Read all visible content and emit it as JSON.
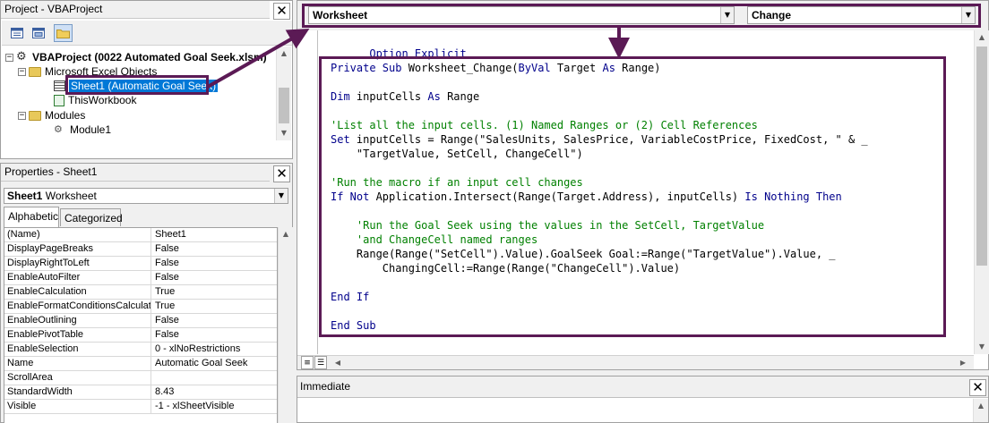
{
  "project": {
    "title": "Project - VBAProject",
    "project_name": "VBAProject (0022 Automated Goal Seek.xlsm)",
    "folder_objects": "Microsoft Excel Objects",
    "sheet1": "Sheet1 (Automatic Goal Seek)",
    "workbook": "ThisWorkbook",
    "folder_modules": "Modules",
    "module1": "Module1"
  },
  "properties": {
    "title": "Properties - Sheet1",
    "object_name": "Sheet1",
    "object_type": "Worksheet",
    "tabs": [
      "Alphabetic",
      "Categorized"
    ],
    "rows": [
      {
        "name": "(Name)",
        "value": "Sheet1"
      },
      {
        "name": "DisplayPageBreaks",
        "value": "False"
      },
      {
        "name": "DisplayRightToLeft",
        "value": "False"
      },
      {
        "name": "EnableAutoFilter",
        "value": "False"
      },
      {
        "name": "EnableCalculation",
        "value": "True"
      },
      {
        "name": "EnableFormatConditionsCalculation",
        "value": "True"
      },
      {
        "name": "EnableOutlining",
        "value": "False"
      },
      {
        "name": "EnablePivotTable",
        "value": "False"
      },
      {
        "name": "EnableSelection",
        "value": "0 - xlNoRestrictions"
      },
      {
        "name": "Name",
        "value": "Automatic Goal Seek"
      },
      {
        "name": "ScrollArea",
        "value": ""
      },
      {
        "name": "StandardWidth",
        "value": "8.43"
      },
      {
        "name": "Visible",
        "value": "-1 - xlSheetVisible"
      }
    ]
  },
  "code": {
    "object_combo": "Worksheet",
    "proc_combo": "Change",
    "lines": {
      "l0": "Option Explicit",
      "l1a": "Private Sub ",
      "l1b": "Worksheet_Change(",
      "l1c": "ByVal ",
      "l1d": "Target ",
      "l1e": "As ",
      "l1f": "Range)",
      "l2a": "Dim ",
      "l2b": "inputCells ",
      "l2c": "As ",
      "l2d": "Range",
      "l3": "'List all the input cells. (1) Named Ranges or (2) Cell References",
      "l4a": "Set ",
      "l4b": "inputCells = Range(\"SalesUnits, SalesPrice, VariableCostPrice, FixedCost, \" & _",
      "l5": "    \"TargetValue, SetCell, ChangeCell\")",
      "l6": "'Run the macro if an input cell changes",
      "l7a": "If Not ",
      "l7b": "Application.Intersect(Range(Target.Address), inputCells) ",
      "l7c": "Is Nothing Then",
      "l8": "    'Run the Goal Seek using the values in the SetCell, TargetValue",
      "l9": "    'and ChangeCell named ranges",
      "l10": "    Range(Range(\"SetCell\").Value).GoalSeek Goal:=Range(\"TargetValue\").Value, _",
      "l11": "        ChangingCell:=Range(Range(\"ChangeCell\").Value)",
      "l12": "End If",
      "l13": "End Sub"
    }
  },
  "immediate": {
    "title": "Immediate"
  },
  "icons": {
    "close": "close-icon",
    "view_code": "view-code-icon",
    "view_object": "view-object-icon",
    "toggle_folders": "toggle-folders-icon"
  },
  "colors": {
    "annotation": "#5b1a55",
    "keyword": "#00008b",
    "comment": "#008000",
    "selection": "#0078d7"
  }
}
